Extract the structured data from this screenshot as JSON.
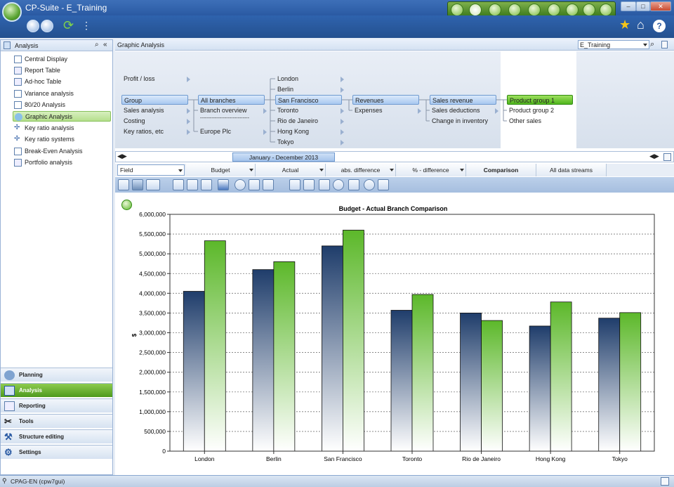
{
  "window": {
    "title": "CP-Suite - E_Training"
  },
  "left_panel": {
    "title": "Analysis",
    "items": [
      {
        "label": "Central Display"
      },
      {
        "label": "Report Table"
      },
      {
        "label": "Ad-hoc Table"
      },
      {
        "label": "Variance analysis"
      },
      {
        "label": "80/20 Analysis"
      },
      {
        "label": "Graphic Analysis",
        "selected": true
      },
      {
        "label": "Key ratio analysis"
      },
      {
        "label": "Key ratio systems"
      },
      {
        "label": "Break-Even Analysis"
      },
      {
        "label": "Portfolio analysis"
      }
    ],
    "modules": [
      {
        "label": "Planning"
      },
      {
        "label": "Analysis",
        "selected": true
      },
      {
        "label": "Reporting"
      },
      {
        "label": "Tools"
      },
      {
        "label": "Structure editing"
      },
      {
        "label": "Settings"
      }
    ]
  },
  "main": {
    "title": "Graphic Analysis",
    "database_select": "E_Training",
    "tree": {
      "col1": [
        "Profit / loss",
        "Group",
        "Sales analysis",
        "Costing",
        "Key ratios, etc"
      ],
      "col2": [
        "All branches",
        "Branch overview",
        "------------------------------",
        "Europe Plc"
      ],
      "col3": [
        "London",
        "Berlin",
        "San Francisco",
        "Toronto",
        "Rio de Janeiro",
        "Hong Kong",
        "Tokyo"
      ],
      "col4": [
        "Revenues",
        "Expenses"
      ],
      "col5": [
        "Sales revenue",
        "Sales deductions",
        "Change in inventory"
      ],
      "col6": [
        "Product group 1",
        "Product group 2",
        "Other sales"
      ]
    },
    "period": "January - December 2013",
    "field_row": {
      "field": "Field",
      "budget": "Budget",
      "actual": "Actual",
      "abs_diff": "abs. difference",
      "pct_diff": "% - difference",
      "comparison": "Comparison",
      "all_streams": "All data streams"
    }
  },
  "chart_data": {
    "type": "bar",
    "title": "Budget - Actual Branch Comparison",
    "ylabel": "$",
    "xlabel": "",
    "categories": [
      "London",
      "Berlin",
      "San Francisco",
      "Toronto",
      "Rio de Janeiro",
      "Hong Kong",
      "Tokyo"
    ],
    "series": [
      {
        "values": [
          4050000,
          4600000,
          5200000,
          3570000,
          3500000,
          3170000,
          3370000
        ],
        "color": "#1f3d6b"
      },
      {
        "values": [
          5330000,
          4800000,
          5600000,
          3970000,
          3310000,
          3780000,
          3510000
        ],
        "color": "#5cb82a"
      }
    ],
    "ylim": [
      0,
      6000000
    ],
    "yticks": [
      "0",
      "500,000",
      "1,000,000",
      "1,500,000",
      "2,000,000",
      "2,500,000",
      "3,000,000",
      "3,500,000",
      "4,000,000",
      "4,500,000",
      "5,000,000",
      "5,500,000",
      "6,000,000"
    ],
    "grid": true,
    "legend": "none"
  },
  "status": {
    "text": "CPAG-EN (cpw7gui)"
  },
  "colors": {
    "accent": "#5cb82a",
    "brand": "#2a5aa3"
  }
}
